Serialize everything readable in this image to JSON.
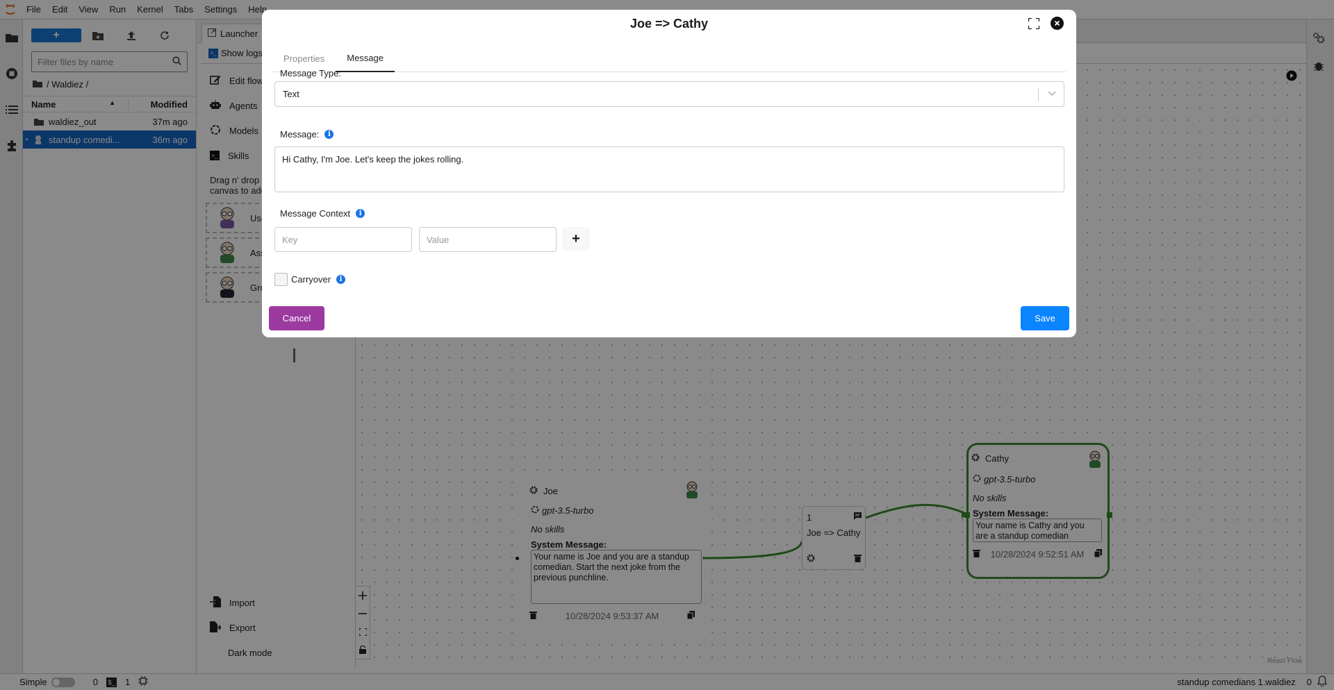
{
  "menubar": {
    "items": [
      "File",
      "Edit",
      "View",
      "Run",
      "Kernel",
      "Tabs",
      "Settings",
      "Help"
    ]
  },
  "leftstrip": {
    "icons": [
      "folder-icon",
      "running-icon",
      "toc-icon",
      "extensions-icon"
    ]
  },
  "filebrowser": {
    "new_label": "+",
    "filter_placeholder": "Filter files by name",
    "breadcrumb": "/ Waldiez /",
    "columns": {
      "name": "Name",
      "modified": "Modified"
    },
    "rows": [
      {
        "name": "waldiez_out",
        "modified": "37m ago",
        "type": "folder",
        "selected": false
      },
      {
        "name": "standup comedi...",
        "modified": "36m ago",
        "type": "waldiez",
        "selected": true
      }
    ]
  },
  "tabbar": {
    "launcher_label": "Launcher"
  },
  "logsbar": {
    "show_logs_label": "Show logs"
  },
  "sidepanel": {
    "items": [
      {
        "label": "Edit flow",
        "icon": "edit-icon"
      },
      {
        "label": "Agents",
        "icon": "robot-icon"
      },
      {
        "label": "Models",
        "icon": "openai-icon"
      },
      {
        "label": "Skills",
        "icon": "terminal-icon"
      }
    ],
    "drag_hint": "Drag n' drop an agent to the canvas to add it to the flow",
    "agents": [
      "User Proxy",
      "Assistant",
      "Group Manager"
    ],
    "bottom_items": [
      {
        "label": "Import",
        "icon": "import-icon"
      },
      {
        "label": "Export",
        "icon": "export-icon"
      },
      {
        "label": "Dark mode",
        "icon": "moon-icon"
      }
    ]
  },
  "canvas": {
    "attribution": "React Flow",
    "nodes": {
      "joe": {
        "name": "Joe",
        "model": "gpt-3.5-turbo",
        "skills": "No skills",
        "system_message_label": "System Message:",
        "system_message": "Your name is Joe and you are a standup comedian. Start the next joke from the previous punchline.",
        "timestamp": "10/28/2024 9:53:37 AM"
      },
      "cathy": {
        "name": "Cathy",
        "model": "gpt-3.5-turbo",
        "skills": "No skills",
        "system_message_label": "System Message:",
        "system_message": "Your name is Cathy and you are a standup comedian",
        "timestamp": "10/28/2024 9:52:51 AM"
      }
    },
    "edge": {
      "order": "1",
      "label": "Joe => Cathy"
    },
    "edge_color": "#3a8a2e"
  },
  "statusbar": {
    "mode_label": "Simple",
    "kernels": "0",
    "terminals": "1",
    "filename": "standup comedians 1.waldiez",
    "notifications": "0"
  },
  "modal": {
    "title": "Joe => Cathy",
    "tabs": [
      {
        "label": "Properties",
        "active": false
      },
      {
        "label": "Message",
        "active": true
      }
    ],
    "message_type_label": "Message Type:",
    "message_type_value": "Text",
    "message_label": "Message:",
    "message_value": "Hi Cathy, I'm Joe. Let's keep the jokes rolling.",
    "context_label": "Message Context",
    "key_placeholder": "Key",
    "value_placeholder": "Value",
    "add_label": "+",
    "carryover_label": "Carryover",
    "carryover_checked": false,
    "cancel_label": "Cancel",
    "save_label": "Save",
    "colors": {
      "cancel": "#9c3aa0",
      "save": "#0a84ff",
      "info": "#1a73e8"
    }
  }
}
